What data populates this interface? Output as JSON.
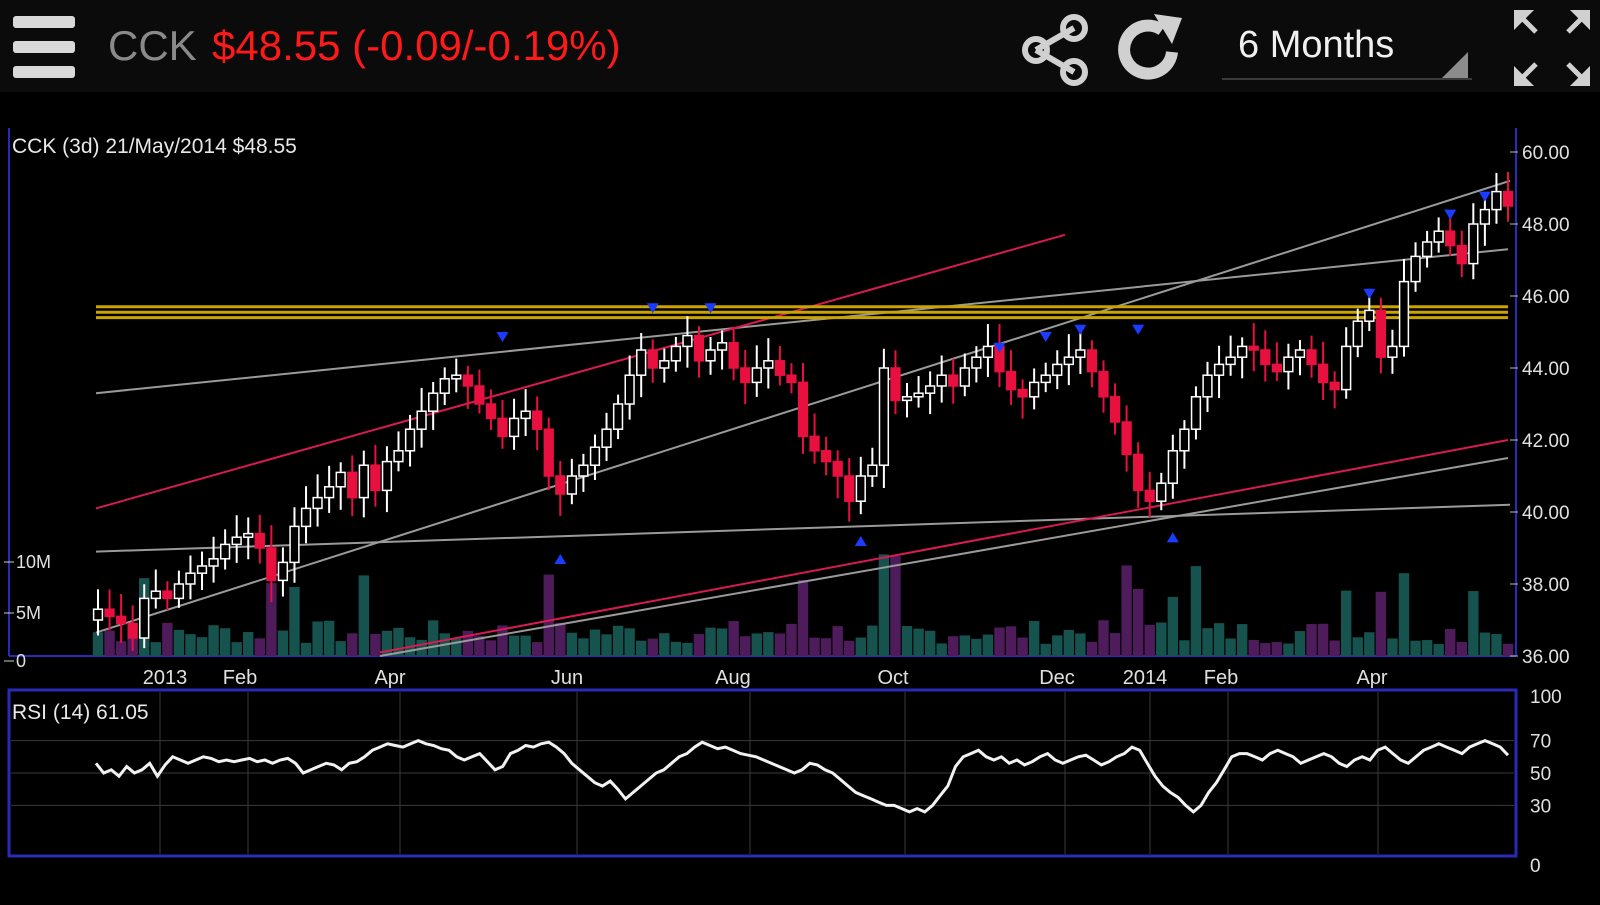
{
  "header": {
    "ticker": "CCK",
    "price_change": "$48.55 (-0.09/-0.19%)",
    "period": "6 Months",
    "icons": [
      "menu-icon",
      "share-icon",
      "refresh-icon",
      "dropdown-triangle-icon",
      "fullscreen-icon"
    ]
  },
  "colors": {
    "background": "#000000",
    "price_negative": "#ff1a1a",
    "candle_up": "#ffffff",
    "candle_down": "#e8103f",
    "frame": "#2a2ab8",
    "trend_gray": "#9a9a9a",
    "trend_red": "#d81b50",
    "resistance_gold": "#c9a400",
    "volume_teal": "#16524e",
    "volume_purple": "#4e1c5a",
    "marker_blue": "#1a3cff"
  },
  "chart_data": [
    {
      "type": "candlestick",
      "legend": "CCK (3d) 21/May/2014 $48.55",
      "ylim": [
        36,
        50
      ],
      "y_ticks": [
        "60.00",
        "48.00",
        "46.00",
        "44.00",
        "42.00",
        "40.00",
        "38.00",
        "36.00"
      ],
      "x_ticks": [
        "2013",
        "Feb",
        "Apr",
        "Jun",
        "Aug",
        "Oct",
        "Dec",
        "2014",
        "Feb",
        "Apr"
      ],
      "volume_ticks": [
        "10M",
        "5M",
        "0"
      ],
      "closes": [
        37.3,
        37.1,
        36.9,
        36.5,
        37.6,
        37.8,
        37.6,
        38.0,
        38.3,
        38.5,
        38.7,
        39.1,
        39.3,
        39.4,
        39.0,
        38.1,
        38.6,
        39.6,
        40.1,
        40.4,
        40.7,
        41.1,
        40.4,
        41.3,
        40.6,
        41.4,
        41.7,
        42.3,
        42.8,
        43.3,
        43.7,
        43.8,
        43.5,
        43.0,
        42.6,
        42.1,
        42.6,
        42.8,
        42.3,
        41.0,
        40.5,
        41.0,
        41.3,
        41.8,
        42.3,
        43.0,
        43.8,
        44.5,
        44.0,
        44.2,
        44.6,
        44.9,
        44.2,
        44.5,
        44.7,
        44.0,
        43.6,
        44.0,
        44.2,
        43.8,
        43.6,
        42.1,
        41.7,
        41.4,
        41.0,
        40.3,
        41.0,
        41.3,
        44.0,
        43.1,
        43.2,
        43.3,
        43.5,
        43.8,
        43.5,
        44.0,
        44.3,
        44.6,
        43.9,
        43.4,
        43.2,
        43.6,
        43.8,
        44.1,
        44.3,
        44.5,
        43.9,
        43.2,
        42.5,
        41.6,
        40.6,
        40.3,
        40.8,
        41.7,
        42.3,
        43.2,
        43.8,
        44.1,
        44.3,
        44.6,
        44.5,
        44.1,
        43.9,
        44.3,
        44.5,
        44.1,
        43.6,
        43.4,
        44.6,
        45.3,
        45.6,
        44.3,
        44.6,
        46.4,
        47.1,
        47.5,
        47.8,
        47.4,
        46.9,
        48.0,
        48.4,
        48.9,
        48.5
      ],
      "markers_down": [
        44.5,
        45.3,
        45.3,
        44.2,
        44.5,
        44.7,
        44.7,
        45.7,
        47.9,
        48.4
      ],
      "markers_up": [
        39.0,
        39.5,
        39.6
      ]
    },
    {
      "type": "line",
      "legend": "RSI (14) 61.05",
      "ylim": [
        0,
        100
      ],
      "y_ticks": [
        "100",
        "70",
        "50",
        "30",
        "0"
      ],
      "values": [
        56,
        50,
        52,
        48,
        54,
        50,
        52,
        56,
        48,
        55,
        60,
        58,
        56,
        58,
        60,
        59,
        57,
        58,
        57,
        58,
        59,
        57,
        58,
        56,
        58,
        59,
        56,
        50,
        52,
        54,
        56,
        55,
        52,
        56,
        57,
        60,
        64,
        66,
        68,
        67,
        66,
        68,
        70,
        68,
        67,
        65,
        64,
        60,
        58,
        60,
        62,
        57,
        52,
        54,
        62,
        64,
        67,
        66,
        68,
        69,
        66,
        62,
        56,
        52,
        48,
        44,
        42,
        45,
        40,
        34,
        38,
        42,
        46,
        50,
        52,
        56,
        60,
        62,
        66,
        69,
        67,
        65,
        66,
        64,
        62,
        61,
        60,
        58,
        56,
        54,
        52,
        50,
        52,
        56,
        55,
        52,
        50,
        46,
        42,
        38,
        36,
        34,
        32,
        30,
        30,
        28,
        26,
        28,
        26,
        30,
        36,
        42,
        54,
        60,
        62,
        64,
        60,
        58,
        60,
        56,
        58,
        55,
        57,
        60,
        62,
        58,
        56,
        58,
        60,
        61,
        58,
        55,
        57,
        60,
        62,
        66,
        64,
        56,
        48,
        42,
        38,
        35,
        30,
        26,
        30,
        38,
        44,
        52,
        60,
        62,
        62,
        60,
        58,
        62,
        64,
        62,
        60,
        56,
        58,
        60,
        62,
        60,
        56,
        54,
        58,
        60,
        58,
        64,
        66,
        62,
        58,
        56,
        60,
        64,
        66,
        68,
        66,
        64,
        62,
        66,
        68,
        70,
        68,
        66,
        61
      ]
    }
  ]
}
